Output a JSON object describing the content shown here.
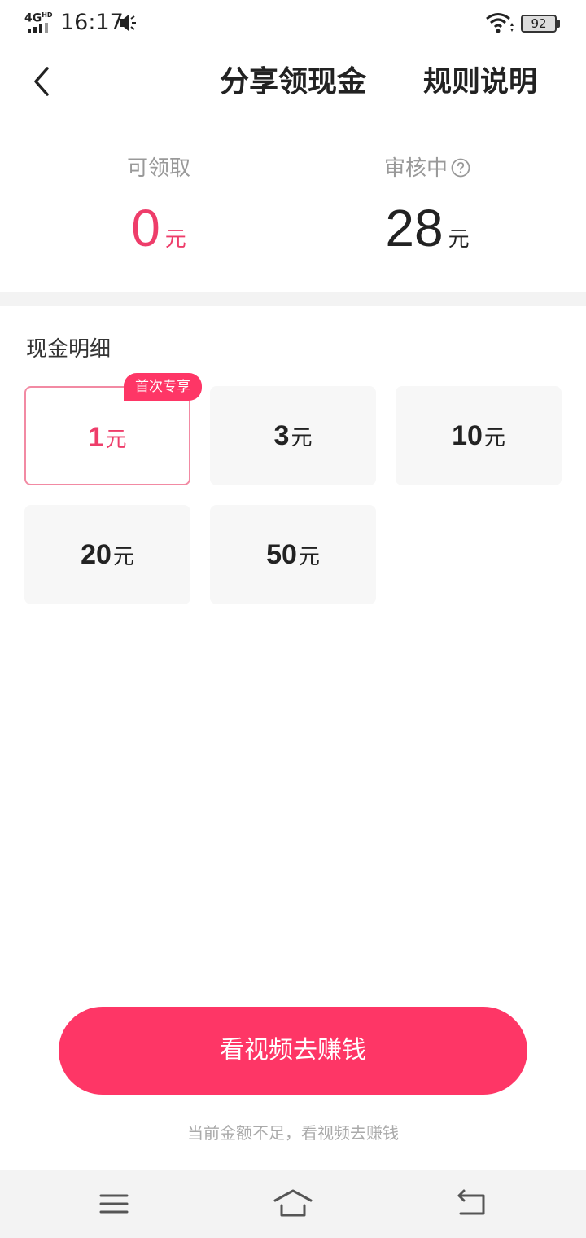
{
  "status_bar": {
    "network": "4G",
    "network_sup": "HD",
    "time": "16:17",
    "battery": "92"
  },
  "header": {
    "title": "分享领现金",
    "rules_label": "规则说明"
  },
  "summary": {
    "available_label": "可领取",
    "available_value": "0",
    "available_unit": "元",
    "reviewing_label": "审核中",
    "reviewing_value": "28",
    "reviewing_unit": "元"
  },
  "cash_detail": {
    "title": "现金明细",
    "items": [
      {
        "amount": "1",
        "unit": "元",
        "badge": "首次专享",
        "selected": true
      },
      {
        "amount": "3",
        "unit": "元"
      },
      {
        "amount": "10",
        "unit": "元"
      },
      {
        "amount": "20",
        "unit": "元"
      },
      {
        "amount": "50",
        "unit": "元"
      }
    ]
  },
  "action": {
    "button_label": "看视频去赚钱",
    "hint": "当前金额不足，看视频去赚钱"
  },
  "colors": {
    "accent": "#fe3666",
    "accent_text": "#ee3d6a",
    "selected_border": "#f28aa3"
  }
}
